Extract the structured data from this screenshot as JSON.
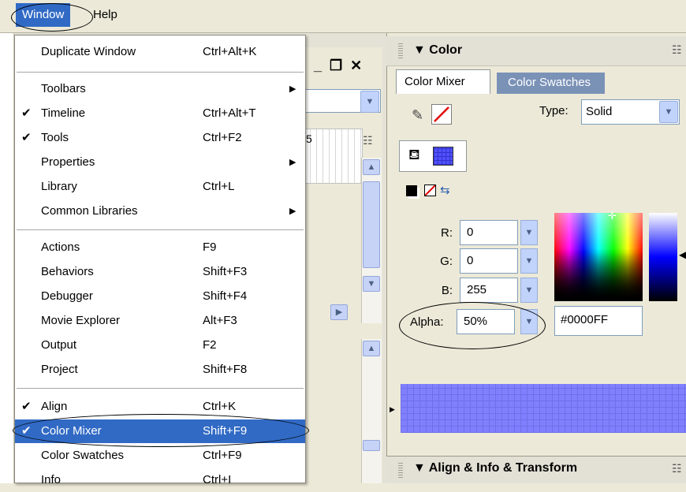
{
  "menubar": {
    "window_label": "Window",
    "help_label": "Help"
  },
  "window_menu": {
    "items": [
      {
        "label": "Duplicate Window",
        "shortcut": "Ctrl+Alt+K",
        "check": "",
        "arrow": ""
      },
      {
        "label": "Toolbars",
        "shortcut": "",
        "check": "",
        "arrow": "▶"
      },
      {
        "label": "Timeline",
        "shortcut": "Ctrl+Alt+T",
        "check": "✔",
        "arrow": ""
      },
      {
        "label": "Tools",
        "shortcut": "Ctrl+F2",
        "check": "✔",
        "arrow": ""
      },
      {
        "label": "Properties",
        "shortcut": "",
        "check": "",
        "arrow": "▶"
      },
      {
        "label": "Library",
        "shortcut": "Ctrl+L",
        "check": "",
        "arrow": ""
      },
      {
        "label": "Common Libraries",
        "shortcut": "",
        "check": "",
        "arrow": "▶"
      },
      {
        "label": "Actions",
        "shortcut": "F9",
        "check": "",
        "arrow": ""
      },
      {
        "label": "Behaviors",
        "shortcut": "Shift+F3",
        "check": "",
        "arrow": ""
      },
      {
        "label": "Debugger",
        "shortcut": "Shift+F4",
        "check": "",
        "arrow": ""
      },
      {
        "label": "Movie Explorer",
        "shortcut": "Alt+F3",
        "check": "",
        "arrow": ""
      },
      {
        "label": "Output",
        "shortcut": "F2",
        "check": "",
        "arrow": ""
      },
      {
        "label": "Project",
        "shortcut": "Shift+F8",
        "check": "",
        "arrow": ""
      },
      {
        "label": "Align",
        "shortcut": "Ctrl+K",
        "check": "✔",
        "arrow": ""
      },
      {
        "label": "Color Mixer",
        "shortcut": "Shift+F9",
        "check": "✔",
        "arrow": ""
      },
      {
        "label": "Color Swatches",
        "shortcut": "Ctrl+F9",
        "check": "",
        "arrow": ""
      },
      {
        "label": "Info",
        "shortcut": "Ctrl+I",
        "check": "",
        "arrow": ""
      }
    ]
  },
  "timeline": {
    "frame_number": "5"
  },
  "color_panel": {
    "title": "Color",
    "tabs": [
      "Color Mixer",
      "Color Swatches"
    ],
    "type_label": "Type:",
    "type_value": "Solid",
    "channels": [
      {
        "label": "R:",
        "value": "0"
      },
      {
        "label": "G:",
        "value": "0"
      },
      {
        "label": "B:",
        "value": "255"
      },
      {
        "label": "Alpha:",
        "value": "50%"
      }
    ],
    "hex_value": "#0000FF",
    "selected_color": "#0000FF",
    "preview_color": "#8080FF"
  },
  "align_panel": {
    "title": "Align & Info & Transform"
  },
  "icons": [
    "pencil-icon",
    "no-stroke-icon",
    "paint-bucket-icon",
    "fill-swatch-icon",
    "black-white-icon",
    "no-color-icon",
    "swap-colors-icon",
    "options-menu-icon",
    "collapse-arrow-icon"
  ]
}
